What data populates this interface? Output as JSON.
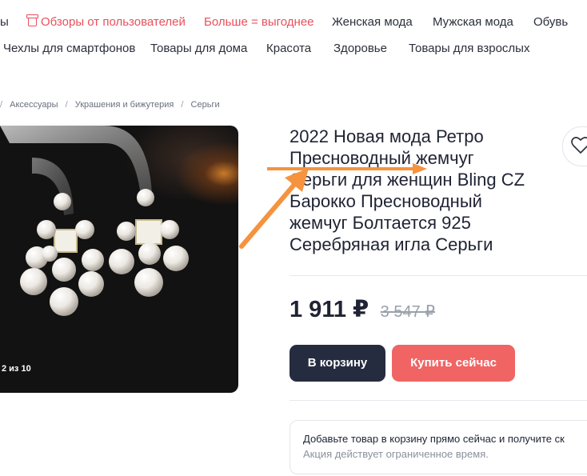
{
  "nav": {
    "row1": {
      "lead_fragment": "ы",
      "reviews": "Обзоры от пользователей",
      "more_cheaper": "Больше = выгоднее",
      "women": "Женская мода",
      "men": "Мужская мода",
      "shoes": "Обувь"
    },
    "row2": {
      "phone_cases": "Чехлы для смартфонов",
      "home": "Товары для дома",
      "beauty": "Красота",
      "health": "Здоровье",
      "adult": "Товары для взрослых"
    }
  },
  "breadcrumb": {
    "lead_sep": "/",
    "items": [
      "Аксессуары",
      "Украшения и бижутерия",
      "Серьги"
    ],
    "sep": "/"
  },
  "gallery": {
    "counter": "2 из 10"
  },
  "product": {
    "title_lines": [
      "2022 Новая мода Ретро",
      "Пресноводный жемчуг",
      "Серьги для женщин Bling CZ",
      "Барокко Пресноводный",
      "жемчуг Болтается 925",
      "Серебряная игла Серьги"
    ],
    "price": "1 911 ₽",
    "old_price": "3 547 ₽"
  },
  "actions": {
    "add_to_cart": "В корзину",
    "buy_now": "Купить сейчас"
  },
  "promo_card": {
    "line1": "Добавьте товар в корзину прямо сейчас и получите ск",
    "line2": "Акция действует ограниченное время."
  },
  "colors": {
    "accent": "#f06464",
    "dark_button": "#262c40",
    "promo_text": "#e8505b",
    "annotation_arrow": "#f5933e"
  },
  "icons": [
    "gift-icon",
    "heart-icon",
    "annotation-arrow-icon"
  ]
}
